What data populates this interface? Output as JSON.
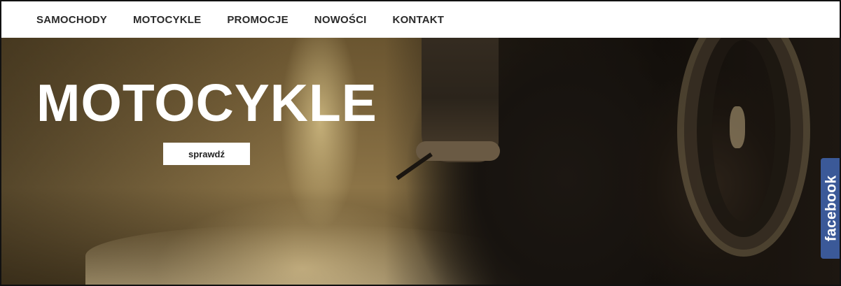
{
  "nav": {
    "items": [
      {
        "label": "SAMOCHODY"
      },
      {
        "label": "MOTOCYKLE"
      },
      {
        "label": "PROMOCJE"
      },
      {
        "label": "NOWOŚCI"
      },
      {
        "label": "KONTAKT"
      }
    ]
  },
  "hero": {
    "title": "MOTOCYKLE",
    "button_label": "sprawdź"
  },
  "social": {
    "facebook_label": "facebook"
  },
  "colors": {
    "nav_background": "#ffffff",
    "nav_text": "#2a2a2a",
    "facebook_blue": "#3b5998",
    "hero_title": "#ffffff"
  }
}
